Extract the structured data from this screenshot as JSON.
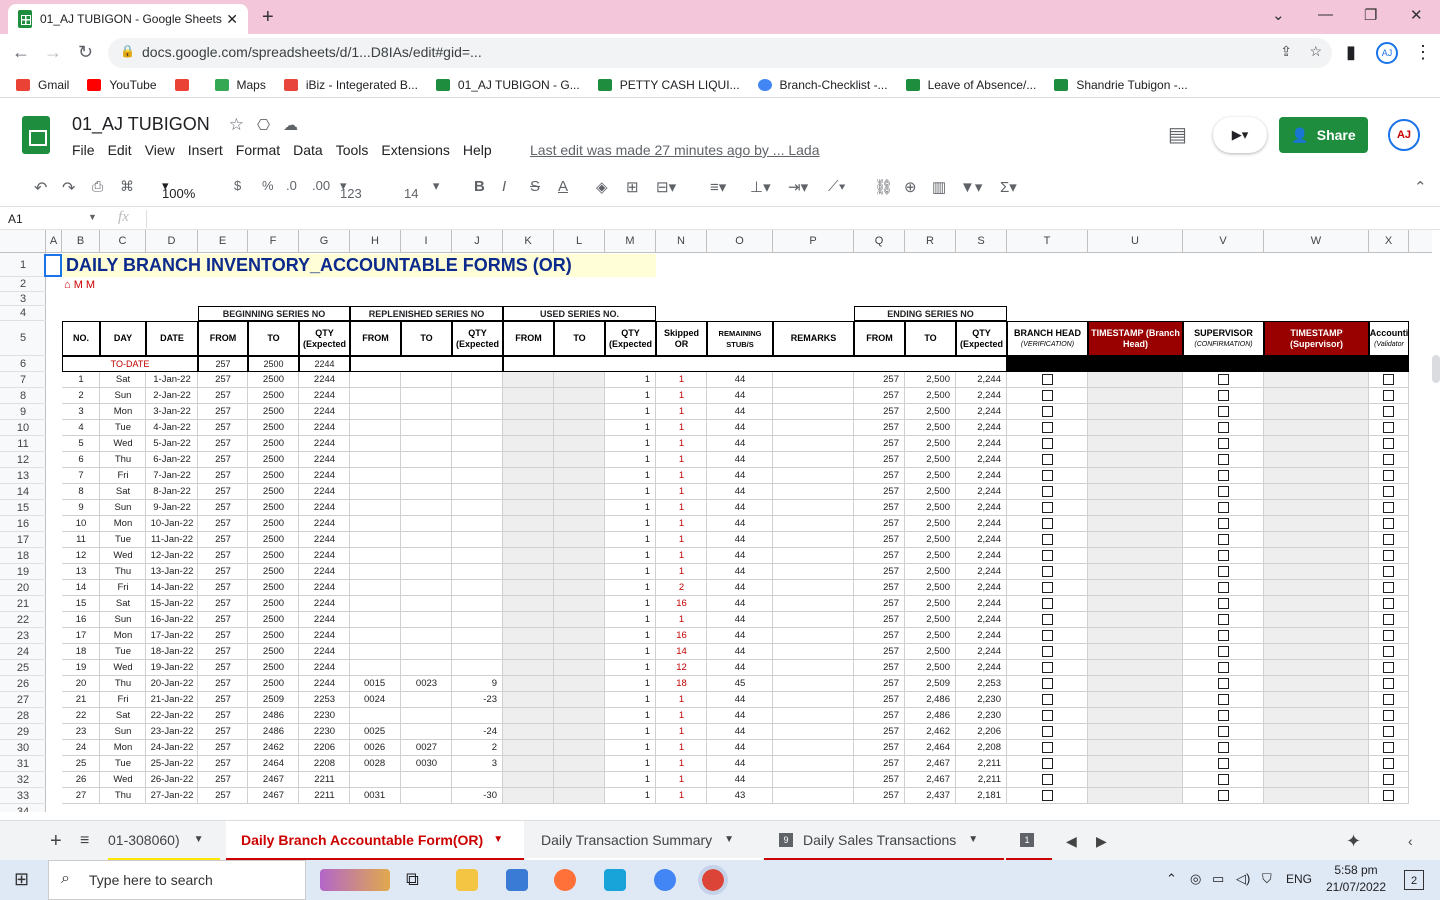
{
  "browser": {
    "tab_title": "01_AJ TUBIGON - Google Sheets",
    "url": "docs.google.com/spreadsheets/d/1...D8IAs/edit#gid=...",
    "bookmarks": [
      "Gmail",
      "YouTube",
      "Maps",
      "iBiz - Integerated B...",
      "01_AJ TUBIGON - G...",
      "PETTY CASH LIQUI...",
      "Branch-Checklist -...",
      "Leave of Absence/...",
      "Shandrie Tubigon -..."
    ]
  },
  "doc": {
    "title": "01_AJ TUBIGON",
    "menus": [
      "File",
      "Edit",
      "View",
      "Insert",
      "Format",
      "Data",
      "Tools",
      "Extensions",
      "Help"
    ],
    "last_edit": "Last edit was made 27 minutes ago by ... Lada",
    "share": "Share",
    "zoom": "100%",
    "font_size": "14",
    "fmt_123": "123",
    "cell_ref": "A1",
    "fx": "fx"
  },
  "columns": [
    "A",
    "B",
    "C",
    "D",
    "E",
    "F",
    "G",
    "H",
    "I",
    "J",
    "K",
    "L",
    "M",
    "N",
    "O",
    "P",
    "Q",
    "R",
    "S",
    "T",
    "U",
    "V",
    "W",
    "X"
  ],
  "sheet": {
    "title": "DAILY BRANCH INVENTORY_ACCOUNTABLE FORMS (OR)",
    "groups": {
      "beginning": "BEGINNING SERIES NO",
      "replenished": "REPLENISHED SERIES NO",
      "used": "USED SERIES NO.",
      "ending": "ENDING SERIES NO"
    },
    "headers": {
      "no": "NO.",
      "day": "DAY",
      "date": "DATE",
      "from": "FROM",
      "to": "TO",
      "qty": "QTY (Expected",
      "skipped": "Skipped OR",
      "remaining": "REMAINING STUB/S",
      "remarks": "REMARKS",
      "branch_head": "BRANCH HEAD",
      "verification": "(VERIFICATION)",
      "ts_bh": "TIMESTAMP (Branch Head)",
      "supervisor": "SUPERVISOR",
      "confirmation": "(CONFIRMATION)",
      "ts_sup": "TIMESTAMP (Supervisor)",
      "accounting": "Accounti",
      "validator": "(Validator"
    },
    "todate": {
      "label": "TO-DATE",
      "from": "257",
      "to": "2500",
      "qty": "2244"
    },
    "rows": [
      {
        "r": "7",
        "no": "1",
        "day": "Sat",
        "date": "1-Jan-22",
        "bf": "257",
        "bt": "2500",
        "bq": "2244",
        "rf": "",
        "rt": "",
        "rq": "",
        "used": "1",
        "skip": "1",
        "rem": "44",
        "ef": "257",
        "et": "2,500",
        "eq": "2,244"
      },
      {
        "r": "8",
        "no": "2",
        "day": "Sun",
        "date": "2-Jan-22",
        "bf": "257",
        "bt": "2500",
        "bq": "2244",
        "rf": "",
        "rt": "",
        "rq": "",
        "used": "1",
        "skip": "1",
        "rem": "44",
        "ef": "257",
        "et": "2,500",
        "eq": "2,244"
      },
      {
        "r": "9",
        "no": "3",
        "day": "Mon",
        "date": "3-Jan-22",
        "bf": "257",
        "bt": "2500",
        "bq": "2244",
        "rf": "",
        "rt": "",
        "rq": "",
        "used": "1",
        "skip": "1",
        "rem": "44",
        "ef": "257",
        "et": "2,500",
        "eq": "2,244"
      },
      {
        "r": "10",
        "no": "4",
        "day": "Tue",
        "date": "4-Jan-22",
        "bf": "257",
        "bt": "2500",
        "bq": "2244",
        "rf": "",
        "rt": "",
        "rq": "",
        "used": "1",
        "skip": "1",
        "rem": "44",
        "ef": "257",
        "et": "2,500",
        "eq": "2,244"
      },
      {
        "r": "11",
        "no": "5",
        "day": "Wed",
        "date": "5-Jan-22",
        "bf": "257",
        "bt": "2500",
        "bq": "2244",
        "rf": "",
        "rt": "",
        "rq": "",
        "used": "1",
        "skip": "1",
        "rem": "44",
        "ef": "257",
        "et": "2,500",
        "eq": "2,244"
      },
      {
        "r": "12",
        "no": "6",
        "day": "Thu",
        "date": "6-Jan-22",
        "bf": "257",
        "bt": "2500",
        "bq": "2244",
        "rf": "",
        "rt": "",
        "rq": "",
        "used": "1",
        "skip": "1",
        "rem": "44",
        "ef": "257",
        "et": "2,500",
        "eq": "2,244"
      },
      {
        "r": "13",
        "no": "7",
        "day": "Fri",
        "date": "7-Jan-22",
        "bf": "257",
        "bt": "2500",
        "bq": "2244",
        "rf": "",
        "rt": "",
        "rq": "",
        "used": "1",
        "skip": "1",
        "rem": "44",
        "ef": "257",
        "et": "2,500",
        "eq": "2,244"
      },
      {
        "r": "14",
        "no": "8",
        "day": "Sat",
        "date": "8-Jan-22",
        "bf": "257",
        "bt": "2500",
        "bq": "2244",
        "rf": "",
        "rt": "",
        "rq": "",
        "used": "1",
        "skip": "1",
        "rem": "44",
        "ef": "257",
        "et": "2,500",
        "eq": "2,244"
      },
      {
        "r": "15",
        "no": "9",
        "day": "Sun",
        "date": "9-Jan-22",
        "bf": "257",
        "bt": "2500",
        "bq": "2244",
        "rf": "",
        "rt": "",
        "rq": "",
        "used": "1",
        "skip": "1",
        "rem": "44",
        "ef": "257",
        "et": "2,500",
        "eq": "2,244"
      },
      {
        "r": "16",
        "no": "10",
        "day": "Mon",
        "date": "10-Jan-22",
        "bf": "257",
        "bt": "2500",
        "bq": "2244",
        "rf": "",
        "rt": "",
        "rq": "",
        "used": "1",
        "skip": "1",
        "rem": "44",
        "ef": "257",
        "et": "2,500",
        "eq": "2,244"
      },
      {
        "r": "17",
        "no": "11",
        "day": "Tue",
        "date": "11-Jan-22",
        "bf": "257",
        "bt": "2500",
        "bq": "2244",
        "rf": "",
        "rt": "",
        "rq": "",
        "used": "1",
        "skip": "1",
        "rem": "44",
        "ef": "257",
        "et": "2,500",
        "eq": "2,244"
      },
      {
        "r": "18",
        "no": "12",
        "day": "Wed",
        "date": "12-Jan-22",
        "bf": "257",
        "bt": "2500",
        "bq": "2244",
        "rf": "",
        "rt": "",
        "rq": "",
        "used": "1",
        "skip": "1",
        "rem": "44",
        "ef": "257",
        "et": "2,500",
        "eq": "2,244"
      },
      {
        "r": "19",
        "no": "13",
        "day": "Thu",
        "date": "13-Jan-22",
        "bf": "257",
        "bt": "2500",
        "bq": "2244",
        "rf": "",
        "rt": "",
        "rq": "",
        "used": "1",
        "skip": "1",
        "rem": "44",
        "ef": "257",
        "et": "2,500",
        "eq": "2,244"
      },
      {
        "r": "20",
        "no": "14",
        "day": "Fri",
        "date": "14-Jan-22",
        "bf": "257",
        "bt": "2500",
        "bq": "2244",
        "rf": "",
        "rt": "",
        "rq": "",
        "used": "1",
        "skip": "2",
        "rem": "44",
        "ef": "257",
        "et": "2,500",
        "eq": "2,244"
      },
      {
        "r": "21",
        "no": "15",
        "day": "Sat",
        "date": "15-Jan-22",
        "bf": "257",
        "bt": "2500",
        "bq": "2244",
        "rf": "",
        "rt": "",
        "rq": "",
        "used": "1",
        "skip": "16",
        "rem": "44",
        "ef": "257",
        "et": "2,500",
        "eq": "2,244"
      },
      {
        "r": "22",
        "no": "16",
        "day": "Sun",
        "date": "16-Jan-22",
        "bf": "257",
        "bt": "2500",
        "bq": "2244",
        "rf": "",
        "rt": "",
        "rq": "",
        "used": "1",
        "skip": "1",
        "rem": "44",
        "ef": "257",
        "et": "2,500",
        "eq": "2,244"
      },
      {
        "r": "23",
        "no": "17",
        "day": "Mon",
        "date": "17-Jan-22",
        "bf": "257",
        "bt": "2500",
        "bq": "2244",
        "rf": "",
        "rt": "",
        "rq": "",
        "used": "1",
        "skip": "16",
        "rem": "44",
        "ef": "257",
        "et": "2,500",
        "eq": "2,244"
      },
      {
        "r": "24",
        "no": "18",
        "day": "Tue",
        "date": "18-Jan-22",
        "bf": "257",
        "bt": "2500",
        "bq": "2244",
        "rf": "",
        "rt": "",
        "rq": "",
        "used": "1",
        "skip": "14",
        "rem": "44",
        "ef": "257",
        "et": "2,500",
        "eq": "2,244"
      },
      {
        "r": "25",
        "no": "19",
        "day": "Wed",
        "date": "19-Jan-22",
        "bf": "257",
        "bt": "2500",
        "bq": "2244",
        "rf": "",
        "rt": "",
        "rq": "",
        "used": "1",
        "skip": "12",
        "rem": "44",
        "ef": "257",
        "et": "2,500",
        "eq": "2,244"
      },
      {
        "r": "26",
        "no": "20",
        "day": "Thu",
        "date": "20-Jan-22",
        "bf": "257",
        "bt": "2500",
        "bq": "2244",
        "rf": "0015",
        "rt": "0023",
        "rq": "9",
        "used": "1",
        "skip": "18",
        "rem": "45",
        "ef": "257",
        "et": "2,509",
        "eq": "2,253"
      },
      {
        "r": "27",
        "no": "21",
        "day": "Fri",
        "date": "21-Jan-22",
        "bf": "257",
        "bt": "2509",
        "bq": "2253",
        "rf": "0024",
        "rt": "",
        "rq": "-23",
        "used": "1",
        "skip": "1",
        "rem": "44",
        "ef": "257",
        "et": "2,486",
        "eq": "2,230"
      },
      {
        "r": "28",
        "no": "22",
        "day": "Sat",
        "date": "22-Jan-22",
        "bf": "257",
        "bt": "2486",
        "bq": "2230",
        "rf": "",
        "rt": "",
        "rq": "",
        "used": "1",
        "skip": "1",
        "rem": "44",
        "ef": "257",
        "et": "2,486",
        "eq": "2,230"
      },
      {
        "r": "29",
        "no": "23",
        "day": "Sun",
        "date": "23-Jan-22",
        "bf": "257",
        "bt": "2486",
        "bq": "2230",
        "rf": "0025",
        "rt": "",
        "rq": "-24",
        "used": "1",
        "skip": "1",
        "rem": "44",
        "ef": "257",
        "et": "2,462",
        "eq": "2,206"
      },
      {
        "r": "30",
        "no": "24",
        "day": "Mon",
        "date": "24-Jan-22",
        "bf": "257",
        "bt": "2462",
        "bq": "2206",
        "rf": "0026",
        "rt": "0027",
        "rq": "2",
        "used": "1",
        "skip": "1",
        "rem": "44",
        "ef": "257",
        "et": "2,464",
        "eq": "2,208"
      },
      {
        "r": "31",
        "no": "25",
        "day": "Tue",
        "date": "25-Jan-22",
        "bf": "257",
        "bt": "2464",
        "bq": "2208",
        "rf": "0028",
        "rt": "0030",
        "rq": "3",
        "used": "1",
        "skip": "1",
        "rem": "44",
        "ef": "257",
        "et": "2,467",
        "eq": "2,211"
      },
      {
        "r": "32",
        "no": "26",
        "day": "Wed",
        "date": "26-Jan-22",
        "bf": "257",
        "bt": "2467",
        "bq": "2211",
        "rf": "",
        "rt": "",
        "rq": "",
        "used": "1",
        "skip": "1",
        "rem": "44",
        "ef": "257",
        "et": "2,467",
        "eq": "2,211"
      },
      {
        "r": "33",
        "no": "27",
        "day": "Thu",
        "date": "27-Jan-22",
        "bf": "257",
        "bt": "2467",
        "bq": "2211",
        "rf": "0031",
        "rt": "",
        "rq": "-30",
        "used": "1",
        "skip": "1",
        "rem": "43",
        "ef": "257",
        "et": "2,437",
        "eq": "2,181"
      }
    ]
  },
  "sheet_tabs": [
    "01-308060)",
    "Daily Branch Accountable Form(OR)",
    "Daily Transaction Summary",
    "Daily Sales Transactions"
  ],
  "taskbar": {
    "search": "Type here to search",
    "lang": "ENG",
    "time": "5:58 pm",
    "date": "21/07/2022",
    "notif": "2"
  }
}
